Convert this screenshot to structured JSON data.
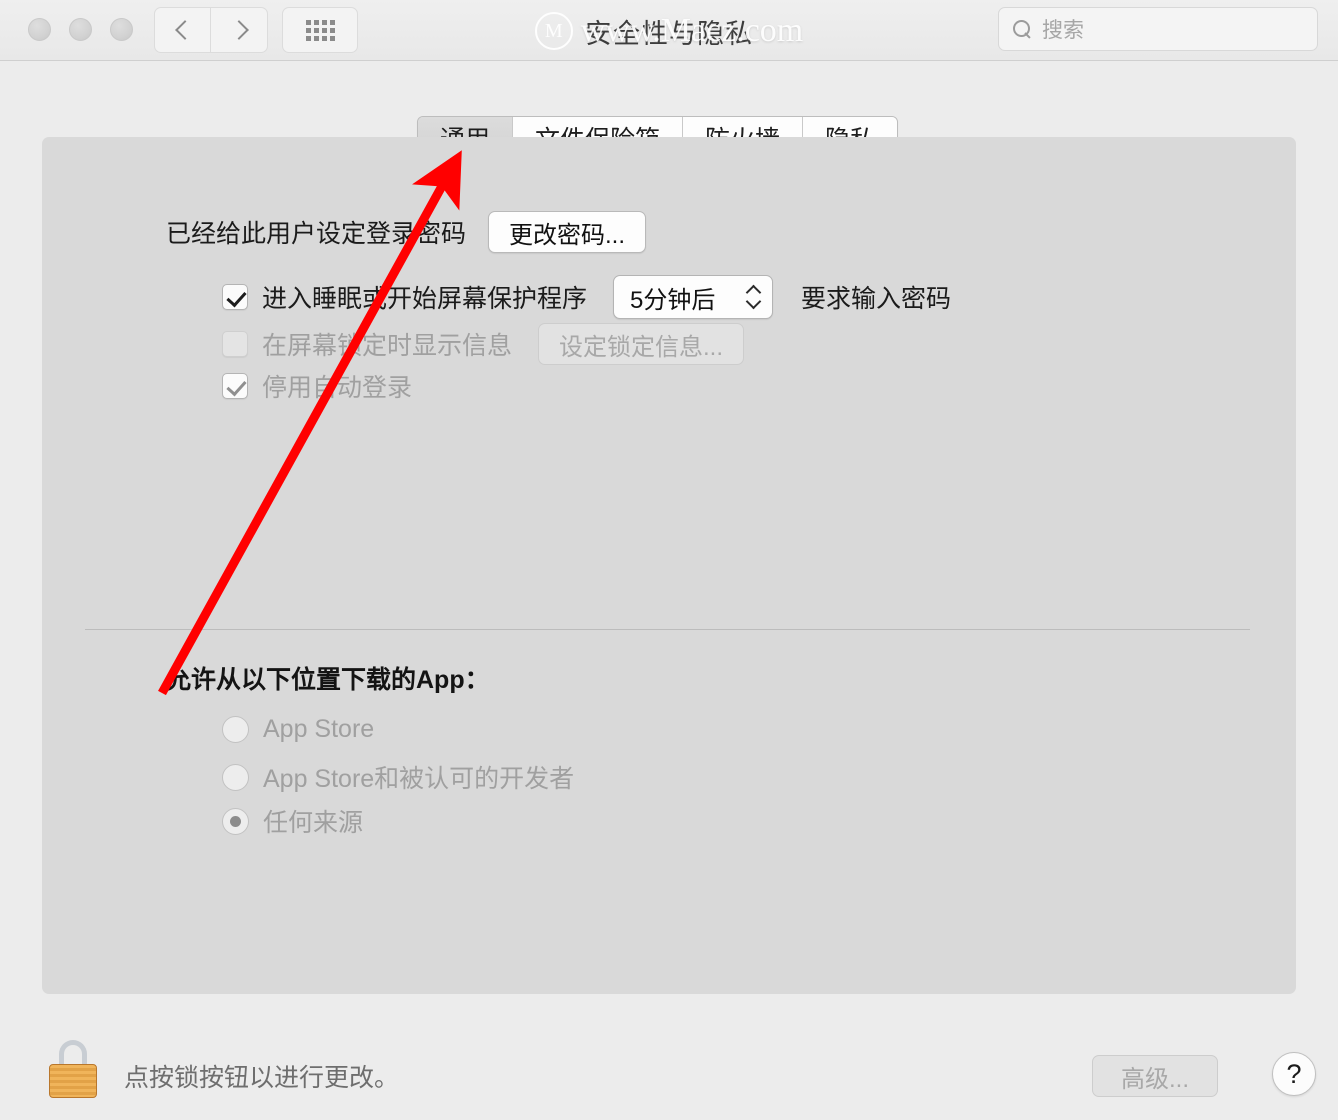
{
  "titlebar": {
    "title": "安全性与隐私",
    "watermark_logo": "M",
    "watermark_text": "www.Macz.com",
    "back_icon": "chevron-left-icon",
    "forward_icon": "chevron-right-icon",
    "showall_icon": "grid-icon",
    "search": {
      "placeholder": "搜索",
      "value": "",
      "icon": "search-icon"
    }
  },
  "tabs": [
    {
      "label": "通用",
      "active": true
    },
    {
      "label": "文件保险箱",
      "active": false
    },
    {
      "label": "防火墙",
      "active": false
    },
    {
      "label": "隐私",
      "active": false
    }
  ],
  "general": {
    "password_status": "已经给此用户设定登录密码",
    "change_password_button": "更改密码...",
    "require_password": {
      "label": "进入睡眠或开始屏幕保护程序",
      "checked": true,
      "enabled": true,
      "delay_value": "5分钟后",
      "suffix": "要求输入密码",
      "stepper_icon": "updown-chevron-icon"
    },
    "show_message": {
      "label": "在屏幕锁定时显示信息",
      "checked": false,
      "enabled": false,
      "button": "设定锁定信息..."
    },
    "disable_auto_login": {
      "label": "停用自动登录",
      "checked": true,
      "enabled": false
    },
    "download_section_title": "允许从以下位置下载的App：",
    "download_options": [
      {
        "label": "App Store",
        "selected": false
      },
      {
        "label": "App Store和被认可的开发者",
        "selected": false
      },
      {
        "label": "任何来源",
        "selected": true
      }
    ]
  },
  "footer": {
    "lock_icon": "lock-closed-icon",
    "lock_message": "点按锁按钮以进行更改。",
    "advanced_button": "高级...",
    "help_button": "?"
  },
  "annotation": {
    "arrow_color": "#FF0000",
    "arrow_from": "162,693",
    "arrow_to": "452,168"
  }
}
